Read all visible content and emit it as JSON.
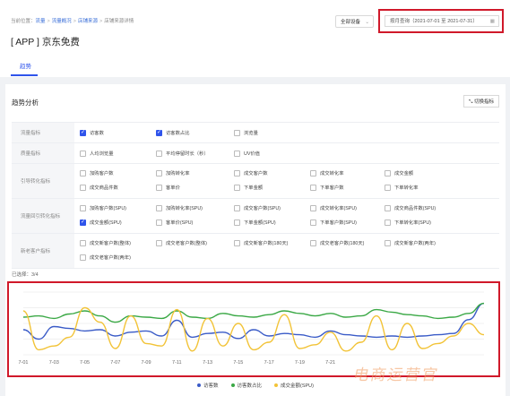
{
  "breadcrumb": {
    "prefix": "当前位置：",
    "items": [
      "流量",
      "流量概况",
      "店铺来源",
      "店铺来源详情"
    ]
  },
  "page_title": "[ APP ] 京东免费",
  "tab": "趋势",
  "all_devices": {
    "value": "全部设备",
    "icon": "chevron-down-icon"
  },
  "date_range": {
    "value": "按月查询（2021-07-01 至 2021-07-31）",
    "icon": "calendar-icon"
  },
  "section": {
    "title": "趋势分析",
    "switch_label": "切换指标"
  },
  "metric_rows": [
    {
      "label": "流量指标",
      "options": [
        {
          "text": "访客数",
          "checked": true
        },
        {
          "text": "访客数占比",
          "checked": true
        },
        {
          "text": "浏览量",
          "checked": false
        }
      ]
    },
    {
      "label": "质量指标",
      "options": [
        {
          "text": "人均浏览量",
          "checked": false
        },
        {
          "text": "平均停留时长（秒）",
          "checked": false
        },
        {
          "text": "UV价值",
          "checked": false
        }
      ]
    },
    {
      "label": "引导转化指标",
      "options": [
        {
          "text": "加购客户数",
          "checked": false
        },
        {
          "text": "加购转化率",
          "checked": false
        },
        {
          "text": "成交客户数",
          "checked": false
        },
        {
          "text": "成交转化率",
          "checked": false
        },
        {
          "text": "成交金额",
          "checked": false
        },
        {
          "text": "成交商品件数",
          "checked": false
        },
        {
          "text": "客单价",
          "checked": false
        },
        {
          "text": "下单金额",
          "checked": false
        },
        {
          "text": "下单客户数",
          "checked": false
        },
        {
          "text": "下单转化率",
          "checked": false
        }
      ]
    },
    {
      "label": "流量回引转化指标",
      "options": [
        {
          "text": "加购客户数(SPU)",
          "checked": false
        },
        {
          "text": "加购转化率(SPU)",
          "checked": false
        },
        {
          "text": "成交客户数(SPU)",
          "checked": false
        },
        {
          "text": "成交转化率(SPU)",
          "checked": false
        },
        {
          "text": "成交商品件数(SPU)",
          "checked": false
        },
        {
          "text": "成交金额(SPU)",
          "checked": true
        },
        {
          "text": "客单价(SPU)",
          "checked": false
        },
        {
          "text": "下单金额(SPU)",
          "checked": false
        },
        {
          "text": "下单客户数(SPU)",
          "checked": false
        },
        {
          "text": "下单转化率(SPU)",
          "checked": false
        }
      ]
    },
    {
      "label": "新老客户指标",
      "options": [
        {
          "text": "成交新客户数(整体)",
          "checked": false
        },
        {
          "text": "成交老客户数(整体)",
          "checked": false
        },
        {
          "text": "成交新客户数(180天)",
          "checked": false
        },
        {
          "text": "成交老客户数(180天)",
          "checked": false
        },
        {
          "text": "成交新客户数(两年)",
          "checked": false
        },
        {
          "text": "成交老客户数(两年)",
          "checked": false
        }
      ]
    }
  ],
  "selected_count": "已选择：3/4",
  "colors": {
    "accent": "#2f54eb",
    "highlight_border": "#d0192a",
    "series": [
      "#3a5bc7",
      "#3aa845",
      "#f2c337"
    ]
  },
  "chart_data": {
    "type": "line",
    "x": [
      "7-01",
      "7-02",
      "7-03",
      "7-04",
      "7-05",
      "7-06",
      "7-07",
      "7-08",
      "7-09",
      "7-10",
      "7-11",
      "7-12",
      "7-13",
      "7-14",
      "7-15",
      "7-16",
      "7-17",
      "7-18",
      "7-19",
      "7-20",
      "7-21",
      "7-22",
      "7-23",
      "7-24",
      "7-25",
      "7-26",
      "7-27",
      "7-28",
      "7-29",
      "7-30",
      "7-31"
    ],
    "tick_labels": [
      "7-01",
      "7-03",
      "7-05",
      "7-07",
      "7-09",
      "7-11",
      "7-13",
      "7-15",
      "7-17",
      "7-19",
      "7-21"
    ],
    "ylim": [
      0,
      100
    ],
    "grid": "horizontal",
    "legend": "bottom-center",
    "series": [
      {
        "name": "访客数",
        "values": [
          40,
          25,
          45,
          42,
          38,
          40,
          30,
          36,
          38,
          30,
          55,
          28,
          34,
          36,
          26,
          40,
          30,
          34,
          32,
          28,
          38,
          32,
          30,
          28,
          30,
          28,
          30,
          32,
          34,
          56,
          82
        ]
      },
      {
        "name": "访客数占比",
        "values": [
          60,
          62,
          58,
          65,
          70,
          62,
          52,
          62,
          60,
          58,
          70,
          60,
          58,
          66,
          62,
          60,
          64,
          70,
          66,
          62,
          66,
          60,
          62,
          72,
          68,
          64,
          62,
          58,
          60,
          66,
          82
        ]
      },
      {
        "name": "成交金额(SPU)",
        "values": [
          70,
          8,
          14,
          28,
          75,
          52,
          10,
          62,
          18,
          14,
          72,
          6,
          58,
          14,
          50,
          8,
          20,
          64,
          10,
          16,
          36,
          6,
          20,
          62,
          8,
          50,
          10,
          18,
          30,
          50,
          32
        ]
      }
    ]
  },
  "watermark": "电商运营官"
}
